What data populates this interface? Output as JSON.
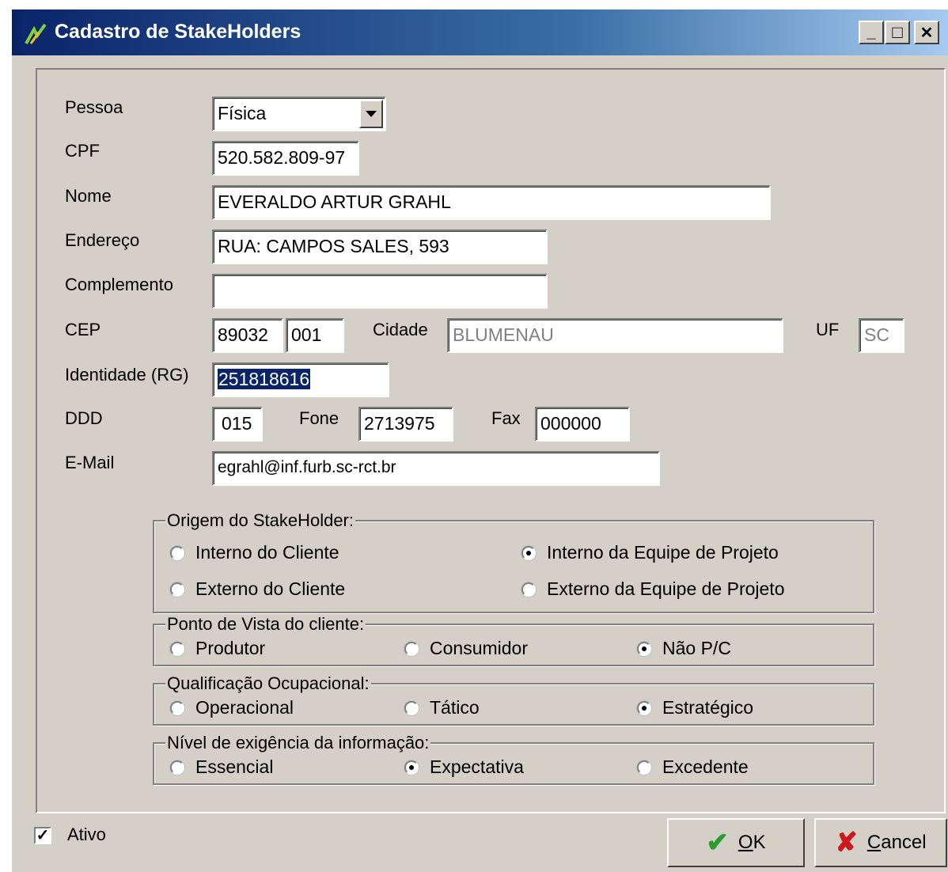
{
  "window": {
    "title": "Cadastro de StakeHolders",
    "min_glyph": "_",
    "max_glyph": "□",
    "close_glyph": "✕"
  },
  "form": {
    "pessoa": {
      "label": "Pessoa",
      "value": "Física"
    },
    "cpf": {
      "label": "CPF",
      "value": "520.582.809-97"
    },
    "nome": {
      "label": "Nome",
      "value": "EVERALDO ARTUR GRAHL"
    },
    "endereco": {
      "label": "Endereço",
      "value": "RUA: CAMPOS SALES, 593"
    },
    "complemento": {
      "label": "Complemento",
      "value": ""
    },
    "cep": {
      "label": "CEP",
      "value1": "89032",
      "value2": "001"
    },
    "cidade": {
      "label": "Cidade",
      "value": "BLUMENAU"
    },
    "uf": {
      "label": "UF",
      "value": "SC"
    },
    "identidade": {
      "label": "Identidade (RG)",
      "value": "251818616"
    },
    "ddd": {
      "label": "DDD",
      "value": "015"
    },
    "fone": {
      "label": "Fone",
      "value": "2713975"
    },
    "fax": {
      "label": "Fax",
      "value": "000000"
    },
    "email": {
      "label": "E-Mail",
      "value": "egrahl@inf.furb.sc-rct.br"
    }
  },
  "groups": {
    "origem": {
      "title": "Origem do StakeHolder:",
      "options": [
        "Interno do Cliente",
        "Interno da  Equipe de Projeto",
        "Externo do Cliente",
        "Externo da Equipe de Projeto"
      ],
      "selected": "Interno da  Equipe de Projeto"
    },
    "ponto": {
      "title": "Ponto de Vista do cliente:",
      "options": [
        "Produtor",
        "Consumidor",
        "Não P/C"
      ],
      "selected": "Não P/C"
    },
    "qualificacao": {
      "title": "Qualificação Ocupacional:",
      "options": [
        "Operacional",
        "Tático",
        "Estratégico"
      ],
      "selected": "Estratégico"
    },
    "nivel": {
      "title": "Nível de exigência da informação:",
      "options": [
        "Essencial",
        "Expectativa",
        "Excedente"
      ],
      "selected": "Expectativa"
    }
  },
  "ativo": {
    "label": "Ativo",
    "checked": true
  },
  "buttons": {
    "ok": {
      "first": "O",
      "rest": "K"
    },
    "cancel": {
      "first": "C",
      "rest": "ancel"
    }
  },
  "colors": {
    "ok_icon": "#2e9b2e",
    "cancel_icon": "#cc1a1a",
    "titlebar": "#0a246a"
  }
}
